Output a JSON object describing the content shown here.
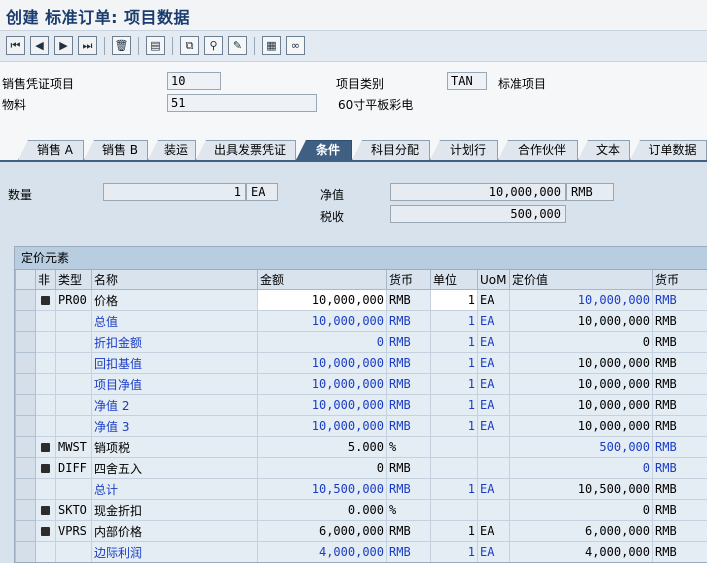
{
  "window": {
    "title": "创建 标准订单: 项目数据"
  },
  "toolbar": {
    "icons": [
      "first-page-icon",
      "previous-page-icon",
      "next-page-icon",
      "last-page-icon",
      "delete-icon",
      "display-document-icon",
      "copy-item-icon",
      "reference-icon",
      "edit-icon",
      "calculator-icon",
      "glasses-icon"
    ]
  },
  "header": {
    "item_label": "销售凭证项目",
    "item_value": "10",
    "category_label": "项目类别",
    "category_value": "TAN",
    "category_text": "标准项目",
    "material_label": "物料",
    "material_value": "51",
    "material_text": "60寸平板彩电"
  },
  "tabs": [
    {
      "label": "销售 A"
    },
    {
      "label": "销售 B"
    },
    {
      "label": "装运"
    },
    {
      "label": "出具发票凭证"
    },
    {
      "label": "条件",
      "active": true
    },
    {
      "label": "科目分配"
    },
    {
      "label": "计划行"
    },
    {
      "label": "合作伙伴"
    },
    {
      "label": "文本"
    },
    {
      "label": "订单数据"
    }
  ],
  "conditions": {
    "qty_label": "数量",
    "qty_value": "1",
    "qty_unit": "EA",
    "net_label": "净值",
    "net_value": "10,000,000",
    "net_currency": "RMB",
    "tax_label": "税收",
    "tax_value": "500,000"
  },
  "pricing": {
    "caption": "定价元素",
    "columns": [
      "非",
      "类型",
      "名称",
      "金额",
      "货币",
      "单位",
      "UoM",
      "定价值",
      "货币"
    ],
    "rows": [
      {
        "type": "PR00",
        "name": "价格",
        "amount": "10,000,000",
        "curr": "RMB",
        "unit": "1",
        "uom": "EA",
        "value": "10,000,000",
        "vcurr": "RMB",
        "chk": true,
        "blue": false,
        "valblue": true,
        "edit": true
      },
      {
        "type": "",
        "name": "总值",
        "amount": "10,000,000",
        "curr": "RMB",
        "unit": "1",
        "uom": "EA",
        "value": "10,000,000",
        "vcurr": "RMB",
        "chk": false,
        "blue": true
      },
      {
        "type": "",
        "name": "折扣金额",
        "amount": "0",
        "curr": "RMB",
        "unit": "1",
        "uom": "EA",
        "value": "0",
        "vcurr": "RMB",
        "chk": false,
        "blue": true
      },
      {
        "type": "",
        "name": "回扣基值",
        "amount": "10,000,000",
        "curr": "RMB",
        "unit": "1",
        "uom": "EA",
        "value": "10,000,000",
        "vcurr": "RMB",
        "chk": false,
        "blue": true
      },
      {
        "type": "",
        "name": "项目净值",
        "amount": "10,000,000",
        "curr": "RMB",
        "unit": "1",
        "uom": "EA",
        "value": "10,000,000",
        "vcurr": "RMB",
        "chk": false,
        "blue": true
      },
      {
        "type": "",
        "name": "净值 2",
        "amount": "10,000,000",
        "curr": "RMB",
        "unit": "1",
        "uom": "EA",
        "value": "10,000,000",
        "vcurr": "RMB",
        "chk": false,
        "blue": true
      },
      {
        "type": "",
        "name": "净值 3",
        "amount": "10,000,000",
        "curr": "RMB",
        "unit": "1",
        "uom": "EA",
        "value": "10,000,000",
        "vcurr": "RMB",
        "chk": false,
        "blue": true
      },
      {
        "type": "MWST",
        "name": "销项税",
        "amount": "5.000",
        "curr": "%",
        "unit": "",
        "uom": "",
        "value": "500,000",
        "vcurr": "RMB",
        "chk": true,
        "blue": false,
        "valblue": true
      },
      {
        "type": "DIFF",
        "name": "四舍五入",
        "amount": "0",
        "curr": "RMB",
        "unit": "",
        "uom": "",
        "value": "0",
        "vcurr": "RMB",
        "chk": true,
        "blue": false,
        "valblue": true
      },
      {
        "type": "",
        "name": "总计",
        "amount": "10,500,000",
        "curr": "RMB",
        "unit": "1",
        "uom": "EA",
        "value": "10,500,000",
        "vcurr": "RMB",
        "chk": false,
        "blue": true
      },
      {
        "type": "SKTO",
        "name": "现金折扣",
        "amount": "0.000",
        "curr": "%",
        "unit": "",
        "uom": "",
        "value": "0",
        "vcurr": "RMB",
        "chk": true,
        "blue": false
      },
      {
        "type": "VPRS",
        "name": "内部价格",
        "amount": "6,000,000",
        "curr": "RMB",
        "unit": "1",
        "uom": "EA",
        "value": "6,000,000",
        "vcurr": "RMB",
        "chk": true,
        "blue": false
      },
      {
        "type": "",
        "name": "边际利润",
        "amount": "4,000,000",
        "curr": "RMB",
        "unit": "1",
        "uom": "EA",
        "value": "4,000,000",
        "vcurr": "RMB",
        "chk": false,
        "blue": true
      }
    ]
  }
}
